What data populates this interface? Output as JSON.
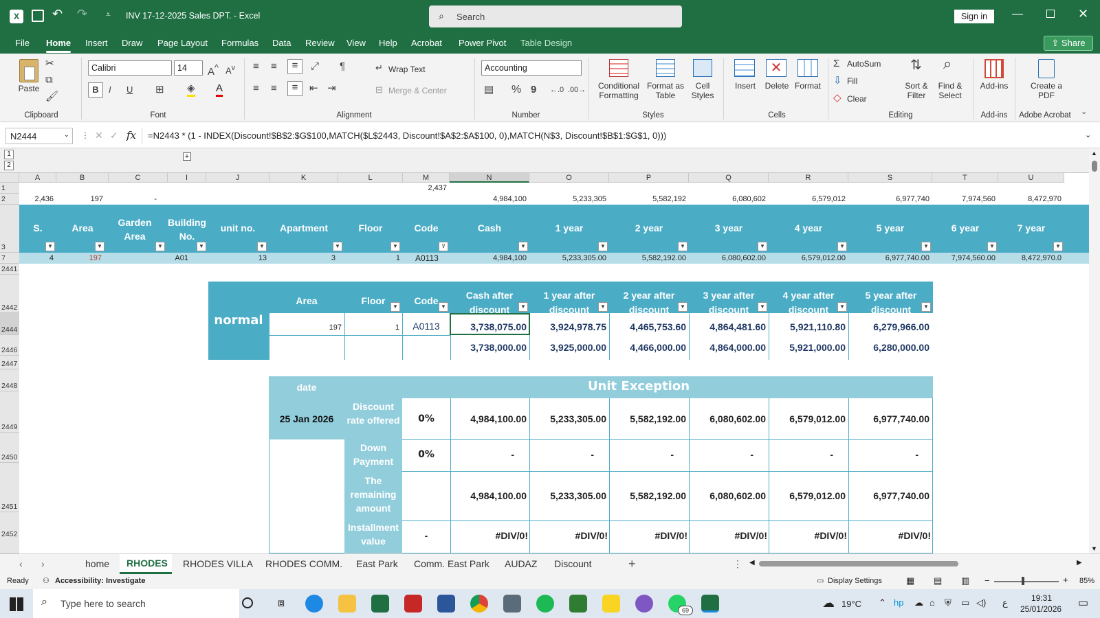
{
  "window": {
    "title": "INV 17-12-2025 Sales DPT.  -  Excel",
    "search_placeholder": "Search",
    "sign_in": "Sign in"
  },
  "menu": {
    "items": [
      "File",
      "Home",
      "Insert",
      "Draw",
      "Page Layout",
      "Formulas",
      "Data",
      "Review",
      "View",
      "Help",
      "Acrobat",
      "Power Pivot",
      "Table Design"
    ],
    "share": "Share"
  },
  "ribbon": {
    "clipboard": {
      "paste": "Paste",
      "label": "Clipboard"
    },
    "font": {
      "name": "Calibri",
      "size": "14",
      "label": "Font",
      "bold": "B",
      "italic": "I",
      "underline": "U"
    },
    "alignment": {
      "wrap": "Wrap Text",
      "merge": "Merge & Center",
      "label": "Alignment"
    },
    "number": {
      "format": "Accounting",
      "label": "Number",
      "percent": "%",
      "comma": "9"
    },
    "styles": {
      "conditional": "Conditional Formatting",
      "format_table": "Format as Table",
      "cell_styles": "Cell Styles",
      "label": "Styles"
    },
    "cells": {
      "insert": "Insert",
      "delete": "Delete",
      "format": "Format",
      "label": "Cells"
    },
    "editing": {
      "autosum": "AutoSum",
      "fill": "Fill",
      "clear": "Clear",
      "sort": "Sort & Filter",
      "find": "Find & Select",
      "label": "Editing"
    },
    "addins": {
      "btn": "Add-ins",
      "label": "Add-ins"
    },
    "acrobat": {
      "btn": "Create a PDF",
      "label": "Adobe Acrobat"
    }
  },
  "formula_bar": {
    "name_box": "N2444",
    "formula": "=N2443 * (1 - INDEX(Discount!$B$2:$G$100,MATCH($L$2443, Discount!$A$2:$A$100, 0),MATCH(N$3, Discount!$B$1:$G$1, 0)))"
  },
  "columns": [
    "A",
    "B",
    "C",
    "I",
    "J",
    "K",
    "L",
    "M",
    "N",
    "O",
    "P",
    "Q",
    "R",
    "S",
    "T",
    "U"
  ],
  "row1": {
    "M": "2,437"
  },
  "row2": {
    "A": "2,436",
    "B": "197",
    "C": "-",
    "N": "4,984,100",
    "O": "5,233,305",
    "P": "5,582,192",
    "Q": "6,080,602",
    "R": "6,579,012",
    "S": "6,977,740",
    "T": "7,974,560",
    "U": "8,472,970"
  },
  "table_headers": [
    "S.",
    "Area",
    "Garden Area",
    "Building No.",
    "unit no.",
    "Apartment",
    "Floor",
    "Code",
    "Cash",
    "1 year",
    "2 year",
    "3 year",
    "4 year",
    "5 year",
    "6 year",
    "7 year"
  ],
  "row7": {
    "A": "4",
    "B": "197",
    "I": "A01",
    "J": "13",
    "K": "3",
    "L": "1",
    "M": "A0113",
    "N": "4,984,100",
    "O": "5,233,305.00",
    "P": "5,582,192.00",
    "Q": "6,080,602.00",
    "R": "6,579,012.00",
    "S": "6,977,740.00",
    "T": "7,974,560.00",
    "U": "8,472,970.0"
  },
  "row_numbers": [
    "1",
    "2",
    "3",
    "7",
    "2441",
    "2442",
    "2444",
    "2446",
    "2447",
    "2448",
    "2449",
    "2450",
    "2451",
    "2452"
  ],
  "normal_block": {
    "label": "normal",
    "headers": [
      "Area",
      "Floor",
      "Code",
      "Cash after discount",
      "1 year after discount",
      "2 year after discount",
      "3 year after discount",
      "4 year after discount",
      "5 year after discount"
    ],
    "row1": [
      "197",
      "1",
      "A0113",
      "3,738,075.00",
      "3,924,978.75",
      "4,465,753.60",
      "4,864,481.60",
      "5,921,110.80",
      "6,279,966.00"
    ],
    "approx": "≈",
    "row2": [
      "3,738,000.00",
      "3,925,000.00",
      "4,466,000.00",
      "4,864,000.00",
      "5,921,000.00",
      "6,280,000.00"
    ]
  },
  "exception_block": {
    "date_label": "date",
    "date_value": "25 Jan 2026",
    "title": "Unit Exception",
    "rows": [
      {
        "label": "Discount rate offered",
        "pct": "0%",
        "values": [
          "4,984,100.00",
          "5,233,305.00",
          "5,582,192.00",
          "6,080,602.00",
          "6,579,012.00",
          "6,977,740.00"
        ]
      },
      {
        "label": "Down Payment",
        "pct": "0%",
        "values": [
          "-",
          "-",
          "-",
          "-",
          "-",
          "-"
        ]
      },
      {
        "label": "The remaining amount",
        "pct": "",
        "values": [
          "4,984,100.00",
          "5,233,305.00",
          "5,582,192.00",
          "6,080,602.00",
          "6,579,012.00",
          "6,977,740.00"
        ]
      },
      {
        "label": "Installment value",
        "pct": "-",
        "values": [
          "#DIV/0!",
          "#DIV/0!",
          "#DIV/0!",
          "#DIV/0!",
          "#DIV/0!",
          "#DIV/0!"
        ]
      }
    ]
  },
  "sheet_tabs": [
    "home",
    "RHODES",
    "RHODES VILLA",
    "RHODES COMM.",
    "East Park",
    "Comm. East Park",
    "AUDAZ",
    "Discount"
  ],
  "active_tab": "RHODES",
  "status": {
    "ready": "Ready",
    "accessibility": "Accessibility: Investigate",
    "display": "Display Settings",
    "zoom": "85%"
  },
  "taskbar": {
    "search": "Type here to search",
    "temp": "19°C",
    "time": "19:31",
    "date": "25/01/2026",
    "badge": "69",
    "lang": "ع"
  },
  "colors": {
    "excel_green": "#1f6f43",
    "header_teal": "#4bacc6",
    "light_teal": "#92cddc",
    "row7_bg": "#b7dee8",
    "navy_text": "#1f3864"
  }
}
